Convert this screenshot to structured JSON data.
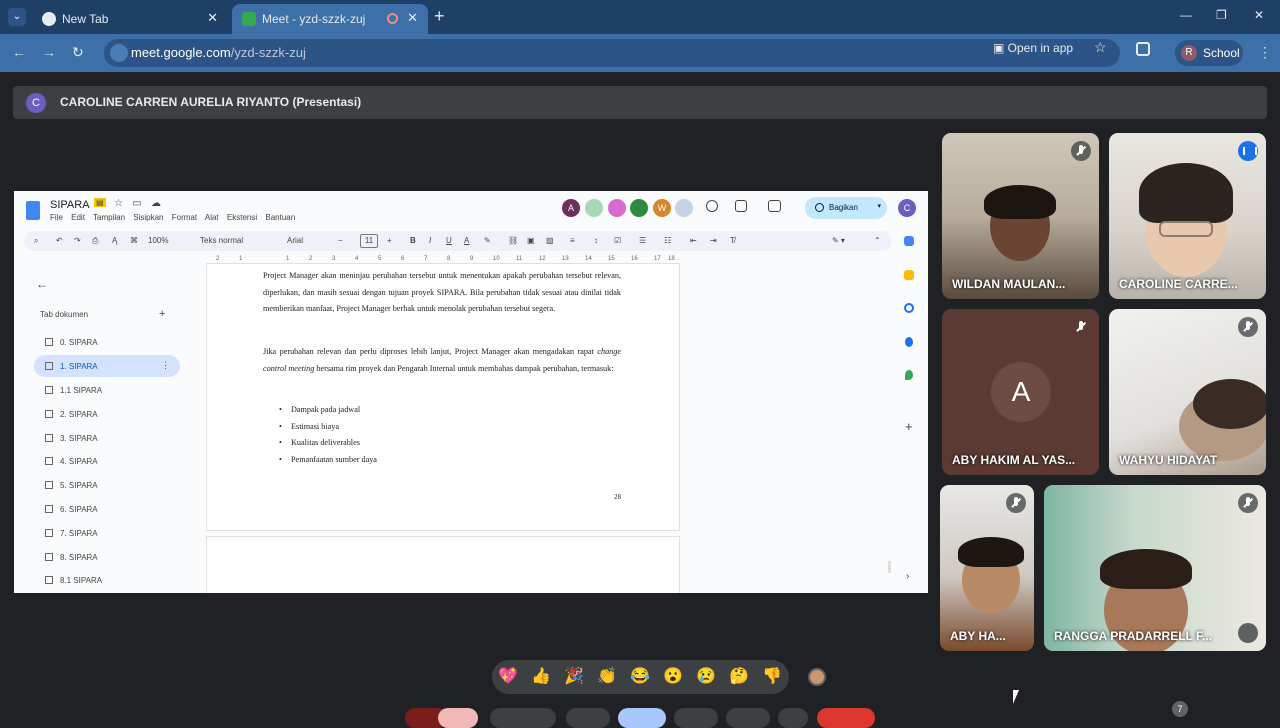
{
  "browser": {
    "tabs": [
      {
        "label": "New Tab"
      },
      {
        "label": "Meet - yzd-szzk-zuj"
      }
    ],
    "url_domain": "meet.google.com",
    "url_path": "/yzd-szzk-zuj",
    "open_in_app": "Open in app",
    "profile_initial": "R",
    "profile_name": "School"
  },
  "meet": {
    "presenter_initial": "C",
    "presenter_label": "CAROLINE CARREN AURELIA RIYANTO (Presentasi)",
    "participants": [
      {
        "name": "WILDAN MAULAN..."
      },
      {
        "name": "CAROLINE CARRE..."
      },
      {
        "name": "ABY HAKIM AL YAS...",
        "initial": "A"
      },
      {
        "name": "WAHYU HIDAYAT"
      },
      {
        "name": "ABY HA..."
      },
      {
        "name": "RANGGA PRADARRELL F..."
      }
    ],
    "reactions": [
      "💖",
      "👍",
      "🎉",
      "👏",
      "😂",
      "😮",
      "😢",
      "🤔",
      "👎"
    ],
    "hidden_count": "7"
  },
  "docs": {
    "title": "SIPARA",
    "menu": [
      "File",
      "Edit",
      "Tampilan",
      "Sisipkan",
      "Format",
      "Alat",
      "Ekstensi",
      "Bantuan"
    ],
    "collaborators": [
      {
        "initial": "A",
        "color": "#6e2f5a"
      },
      {
        "initial": "",
        "color": "#a6d8b4"
      },
      {
        "initial": "",
        "color": "#d96bd0"
      },
      {
        "initial": "",
        "color": "#2e8a3e"
      },
      {
        "initial": "W",
        "color": "#d9862a"
      },
      {
        "initial": "",
        "color": "#c5d3ea"
      }
    ],
    "share_label": "Bagikan",
    "me_initial": "C",
    "toolbar": {
      "zoom": "100%",
      "style": "Teks normal",
      "font": "Arial",
      "font_size": "11"
    },
    "ruler_ticks": [
      "2",
      "1",
      "1",
      "2",
      "3",
      "4",
      "5",
      "6",
      "7",
      "8",
      "9",
      "10",
      "11",
      "12",
      "13",
      "14",
      "15",
      "16",
      "17",
      "18"
    ],
    "sidebar": {
      "heading": "Tab dokumen",
      "items": [
        "0. SIPARA",
        "1. SIPARA",
        "1.1 SIPARA",
        "2. SIPARA",
        "3. SIPARA",
        "4. SIPARA",
        "5. SIPARA",
        "6. SIPARA",
        "7. SIPARA",
        "8. SIPARA",
        "8.1 SIPARA"
      ],
      "active_index": 1
    },
    "body": {
      "para1": "Project Manager akan meninjau perubahan tersebut untuk menentukan apakah perubahan tersebut relevan, diperlukan, dan masih sesuai dengan tujuan proyek SIPARA. Bila perubahan tidak sesuai atau dinilai tidak memberikan manfaat, Project Manager berhak untuk menolak perubahan tersebut segera.",
      "para2_a": "Jika perubahan relevan dan perlu diproses lebih lanjut, Project Manager akan mengadakan rapat ",
      "para2_em": "change control meeting",
      "para2_b": " bersama tim proyek dan Pengarah Internal untuk membahas dampak perubahan, termasuk:",
      "bullets": [
        "Dampak pada jadwal",
        "Estimasi biaya",
        "Kualitas deliverables",
        "Pemanfaatan sumber daya"
      ],
      "page_number": "28"
    }
  }
}
